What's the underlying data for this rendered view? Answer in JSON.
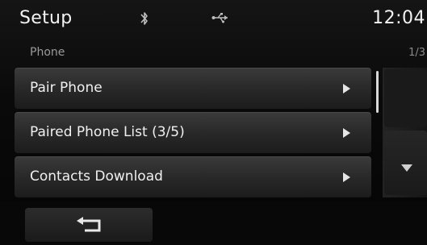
{
  "status_bar": {
    "title": "Setup",
    "clock": "12:04",
    "icons": [
      "bluetooth-icon",
      "usb-icon"
    ]
  },
  "section": {
    "title": "Phone",
    "page_indicator": "1/3"
  },
  "menu": {
    "items": [
      {
        "label": "Pair Phone"
      },
      {
        "label": "Paired Phone List (3/5)"
      },
      {
        "label": "Contacts Download"
      }
    ]
  },
  "bottom_bar": {
    "back_icon": "back-arrow-icon"
  },
  "colors": {
    "background": "#0a0a0a",
    "text": "#f0f0f0",
    "subtle_text": "#9a9a9a",
    "item_bg": "#2a2a2a"
  }
}
